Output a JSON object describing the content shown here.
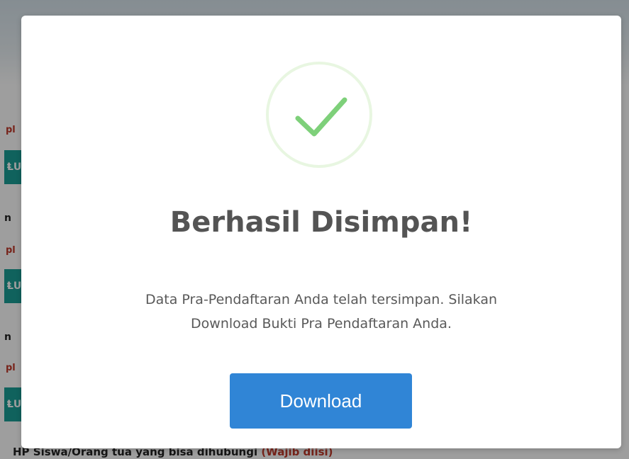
{
  "background": {
    "hint_fragment": "pl",
    "label_fragment": "n",
    "button_fragment": "&#x2C60;U",
    "footer_label": "HP Siswa/Orang tua yang bisa dihubungi ",
    "footer_required": "(Wajib diisi)"
  },
  "modal": {
    "icon": "success-check-icon",
    "title": "Berhasil Disimpan!",
    "text_line1": "Data Pra-Pendaftaran Anda telah tersimpan. Silakan",
    "text_line2": "Download Bukti Pra Pendaftaran Anda.",
    "download_label": "Download"
  },
  "colors": {
    "accent": "#3085d6",
    "success": "#7ed07a",
    "title": "#545454",
    "required": "#c0392b",
    "background_button": "#1a9e96"
  }
}
